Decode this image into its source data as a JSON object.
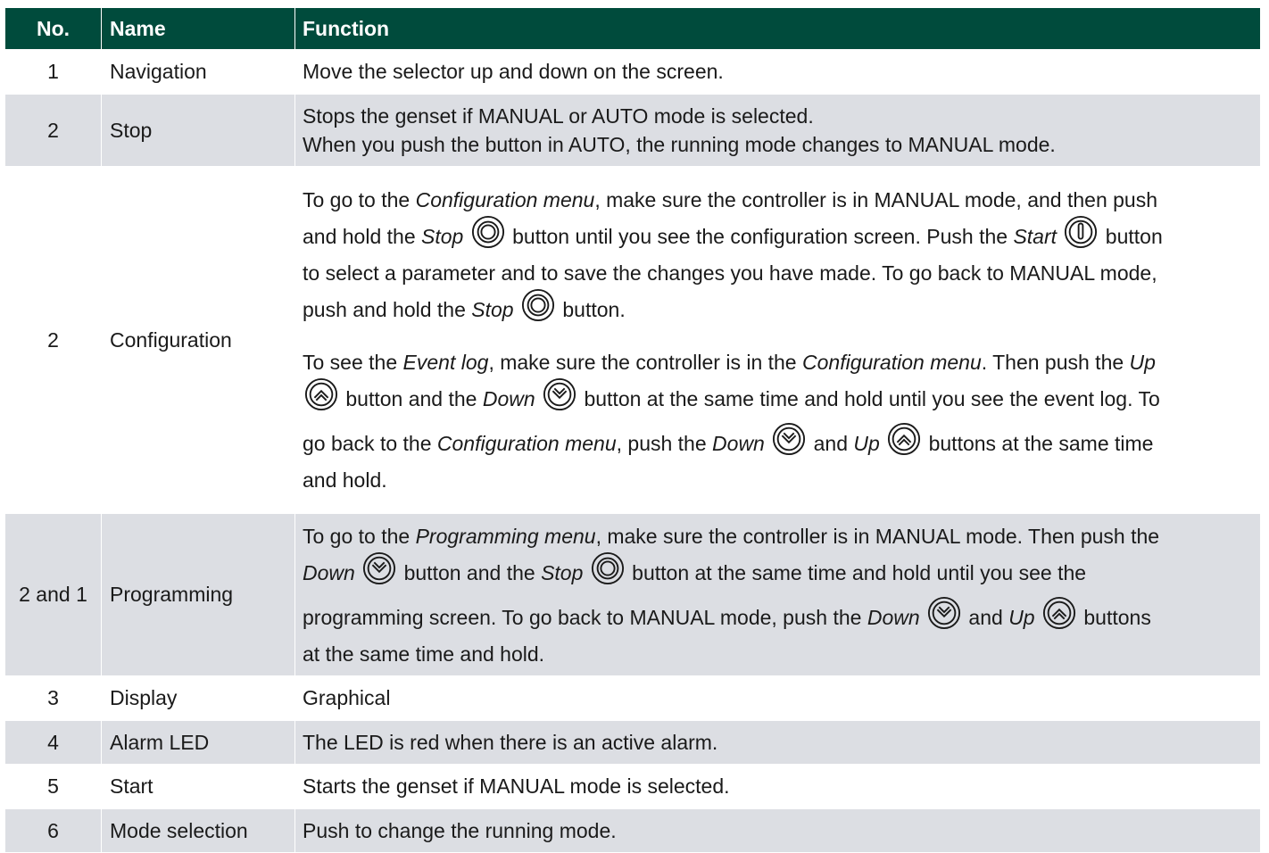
{
  "header": {
    "no": "No.",
    "name": "Name",
    "function": "Function"
  },
  "rows": [
    {
      "no": "1",
      "name": "Navigation",
      "function": "Move the selector up and down on the screen."
    },
    {
      "no": "2",
      "name": "Stop",
      "line1": "Stops the genset if MANUAL or AUTO mode is selected.",
      "line2": "When you push the button in AUTO, the running mode changes to MANUAL mode."
    },
    {
      "no": "2",
      "name": "Configuration",
      "p1": {
        "a": "To go to the ",
        "b": "Configuration menu",
        "c": ", make sure the controller is in MANUAL mode, and then push",
        "d": "and hold the ",
        "e": "Stop",
        "f": " button until you see the configuration screen. Push the ",
        "g": "Start",
        "h": " button",
        "i": "to select a parameter and to save the changes you have made. To go back to MANUAL mode,",
        "j": "push and hold the ",
        "k": "Stop",
        "l": " button."
      },
      "p2": {
        "a": "To see the ",
        "b": "Event log",
        "c": ", make sure the controller is in the ",
        "d": "Configuration menu",
        "e": ". Then push the ",
        "f": "Up",
        "g": " button and the ",
        "h": "Down",
        "i": " button at the same time and hold until you see the event log. To",
        "j": "go back to the ",
        "k": "Configuration menu",
        "l": ", push the ",
        "m": "Down",
        "n": " and ",
        "o": "Up",
        "p": " buttons at the same time",
        "q": "and hold."
      }
    },
    {
      "no": "2 and 1",
      "name": "Programming",
      "p": {
        "a": "To go to the ",
        "b": "Programming menu",
        "c": ", make sure the controller is in MANUAL mode. Then push the",
        "d": "Down",
        "e": " button and the ",
        "f": "Stop",
        "g": " button at the same time and hold until you see the",
        "h": "programming screen. To go back to MANUAL mode, push the ",
        "i": "Down",
        "j": " and ",
        "k": "Up",
        "l": " buttons",
        "m": "at the same time and hold."
      }
    },
    {
      "no": "3",
      "name": "Display",
      "function": "Graphical"
    },
    {
      "no": "4",
      "name": "Alarm LED",
      "function": "The LED is red when there is an active alarm."
    },
    {
      "no": "5",
      "name": "Start",
      "function": "Starts the genset if MANUAL mode is selected."
    },
    {
      "no": "6",
      "name": "Mode selection",
      "function": "Push to change the running mode."
    }
  ],
  "icons": {
    "stop": "stop-button-icon",
    "start": "start-button-icon",
    "up": "up-button-icon",
    "down": "down-button-icon"
  },
  "colors": {
    "header_bg": "#004b3c",
    "row_grey": "#dcdee3",
    "row_white": "#ffffff"
  }
}
